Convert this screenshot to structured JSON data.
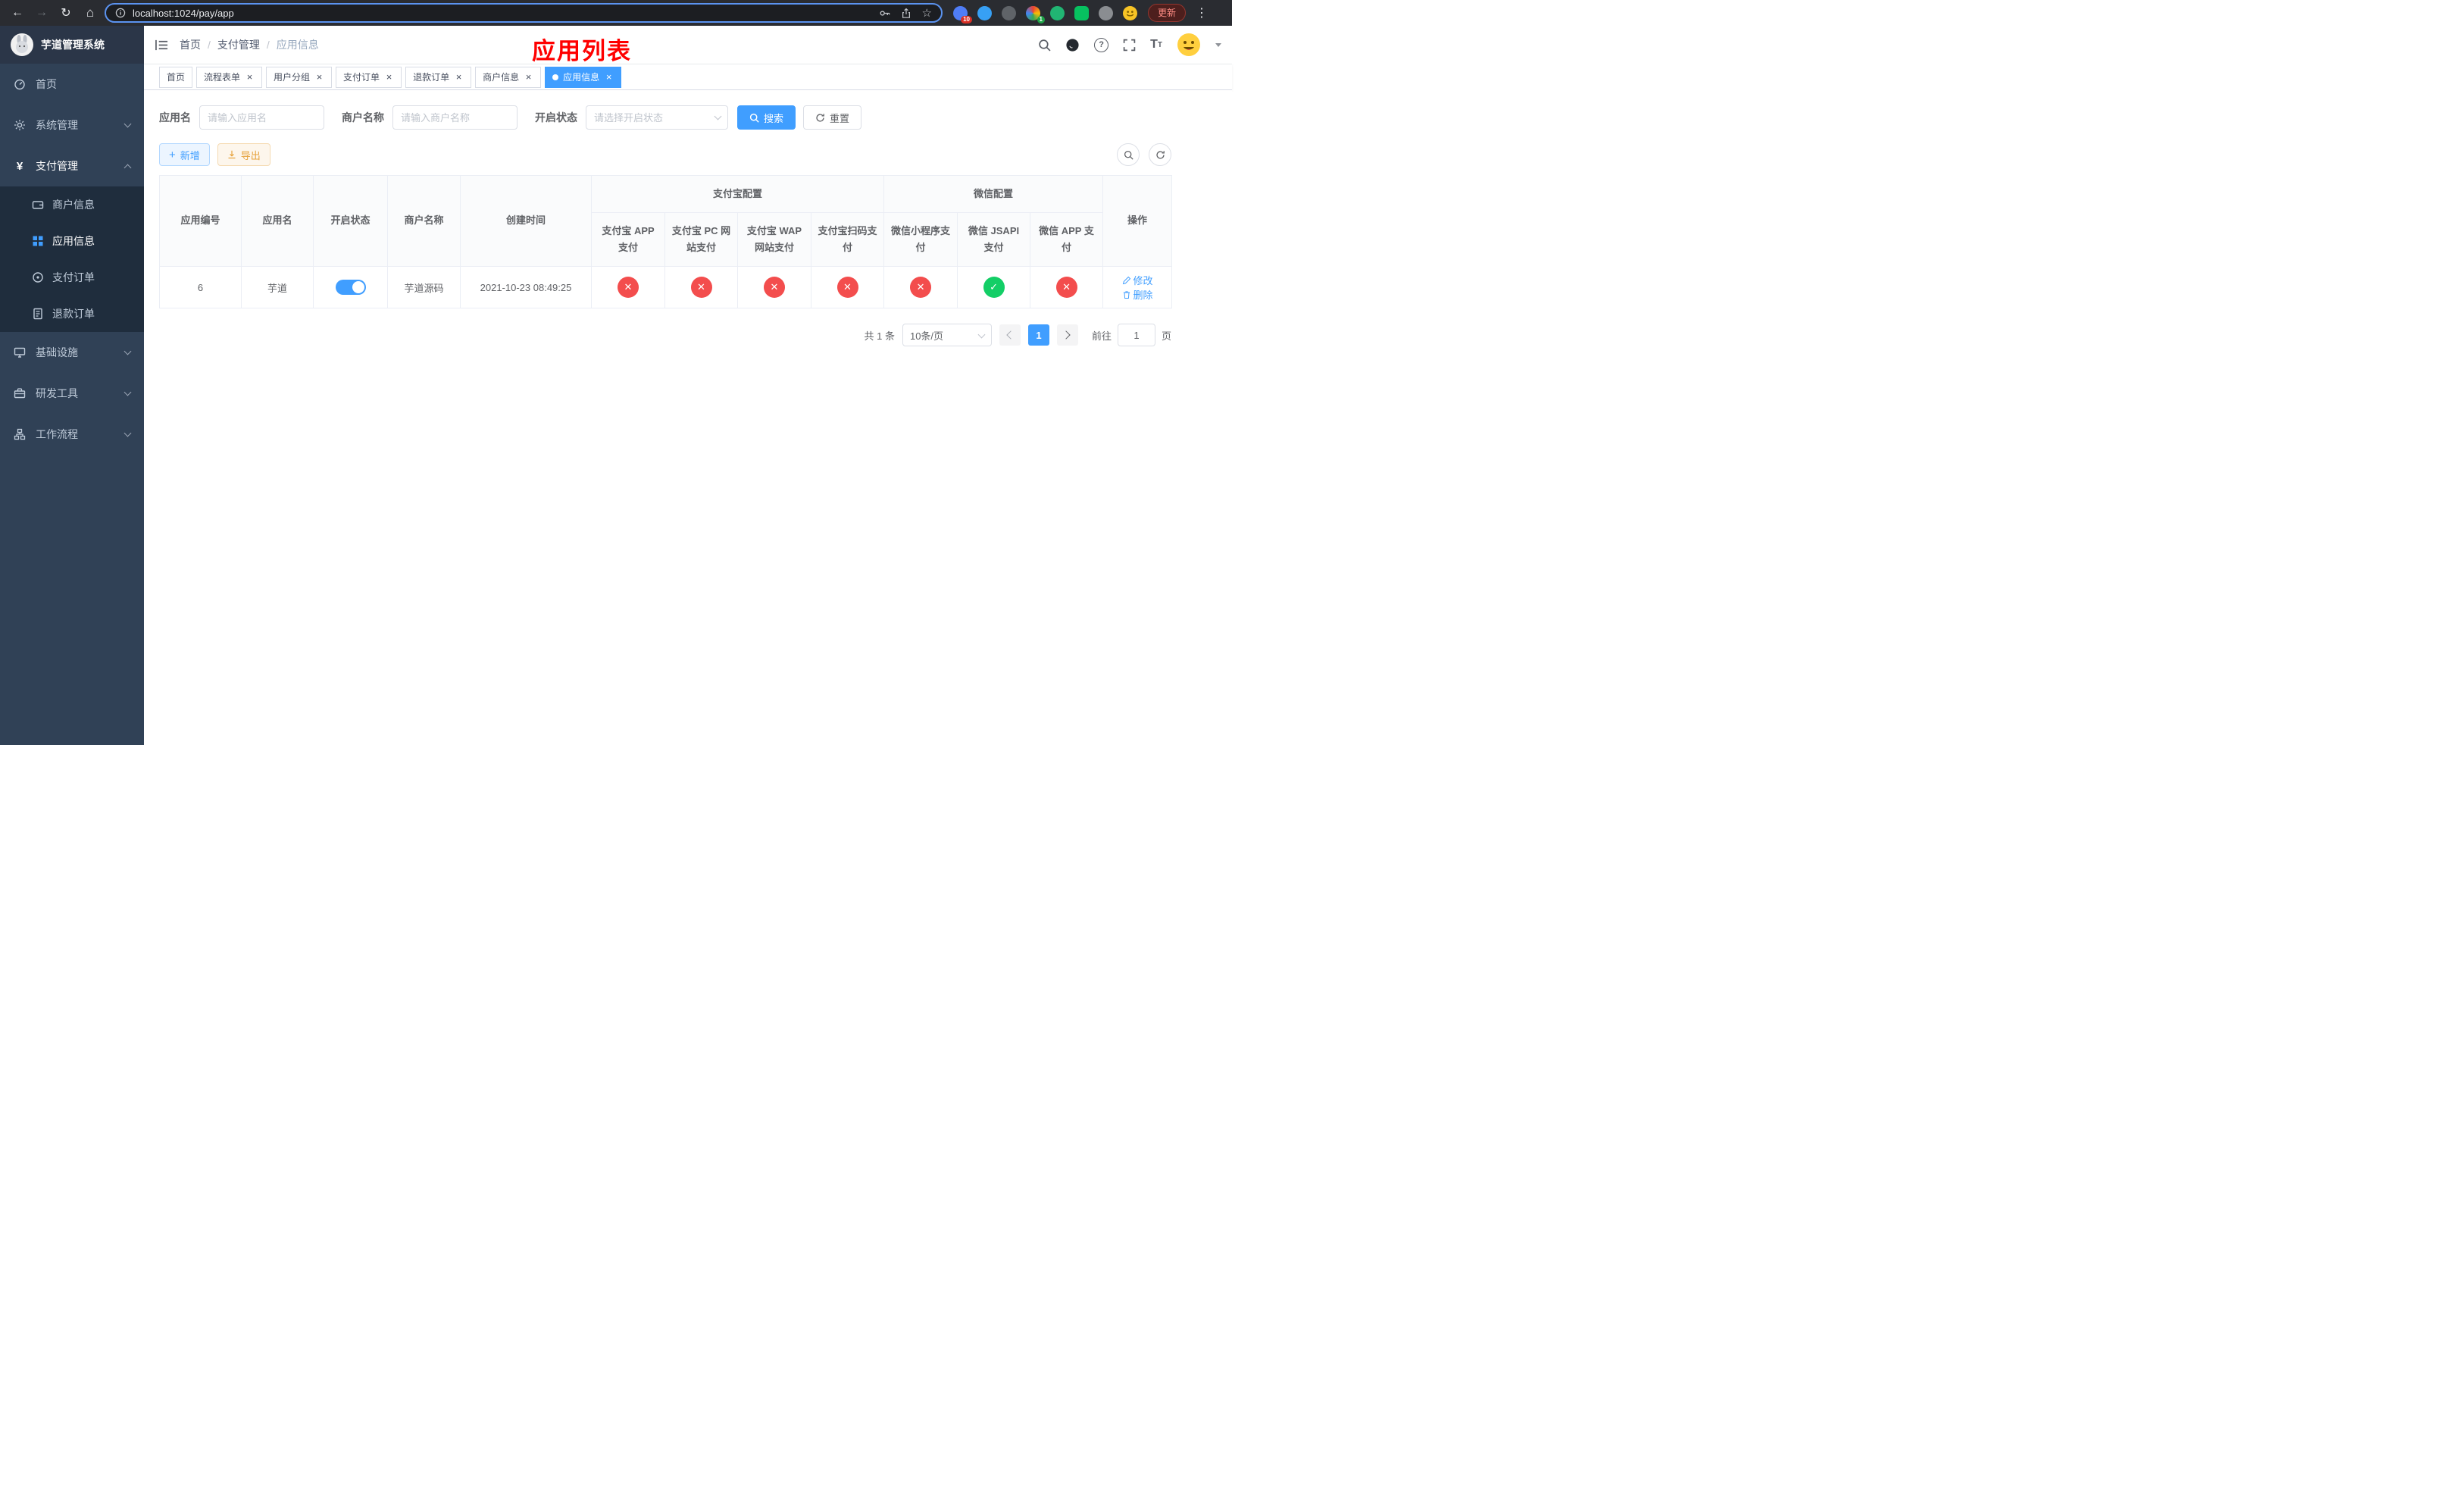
{
  "browser": {
    "url": "localhost:1024/pay/app",
    "update_label": "更新",
    "badges": {
      "extension1": "10",
      "extension4": "1"
    }
  },
  "sidebar": {
    "title": "芋道管理系统",
    "items": [
      {
        "label": "首页"
      },
      {
        "label": "系统管理"
      },
      {
        "label": "支付管理",
        "children": [
          {
            "label": "商户信息"
          },
          {
            "label": "应用信息"
          },
          {
            "label": "支付订单"
          },
          {
            "label": "退款订单"
          }
        ]
      },
      {
        "label": "基础设施"
      },
      {
        "label": "研发工具"
      },
      {
        "label": "工作流程"
      }
    ]
  },
  "header": {
    "breadcrumb": [
      "首页",
      "支付管理",
      "应用信息"
    ],
    "overlay_title": "应用列表"
  },
  "tabs": [
    {
      "label": "首页"
    },
    {
      "label": "流程表单"
    },
    {
      "label": "用户分组"
    },
    {
      "label": "支付订单"
    },
    {
      "label": "退款订单"
    },
    {
      "label": "商户信息"
    },
    {
      "label": "应用信息"
    }
  ],
  "filters": {
    "app_name": {
      "label": "应用名",
      "placeholder": "请输入应用名",
      "value": ""
    },
    "merchant_name": {
      "label": "商户名称",
      "placeholder": "请输入商户名称",
      "value": ""
    },
    "status": {
      "label": "开启状态",
      "placeholder": "请选择开启状态"
    },
    "search_label": "搜索",
    "reset_label": "重置"
  },
  "toolbar": {
    "add_label": "新增",
    "export_label": "导出"
  },
  "table": {
    "groups": [
      {
        "label": "支付宝配置"
      },
      {
        "label": "微信配置"
      }
    ],
    "columns": [
      "应用编号",
      "应用名",
      "开启状态",
      "商户名称",
      "创建时间",
      "支付宝 APP 支付",
      "支付宝 PC 网站支付",
      "支付宝 WAP 网站支付",
      "支付宝扫码支付",
      "微信小程序支付",
      "微信 JSAPI 支付",
      "微信 APP 支付",
      "操作"
    ],
    "rows": [
      {
        "id": "6",
        "app_name": "芋道",
        "status_on": true,
        "merchant_name": "芋道源码",
        "create_time": "2021-10-23 08:49:25",
        "statuses": [
          "fail",
          "fail",
          "fail",
          "fail",
          "fail",
          "ok",
          "fail"
        ],
        "edit_label": "修改",
        "delete_label": "删除"
      }
    ]
  },
  "pagination": {
    "total": "共 1 条",
    "page_size": "10条/页",
    "current_page": "1",
    "goto_label": "前往",
    "goto_value": "1",
    "unit_label": "页"
  },
  "colors": {
    "accent": "#409eff",
    "danger": "#f34d4d",
    "success": "#13ce66",
    "warning": "#e6a23c",
    "sidebar_bg": "#304156",
    "submenu_bg": "#1f2d3d",
    "title_red": "#ff0000"
  }
}
